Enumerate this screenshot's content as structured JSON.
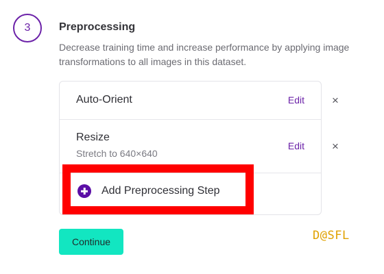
{
  "step": {
    "number": "3",
    "title": "Preprocessing",
    "description": "Decrease training time and increase performance by applying image transformations to all images in this dataset."
  },
  "preprocessing_steps": [
    {
      "name": "Auto-Orient",
      "detail": "",
      "edit_label": "Edit",
      "remove_label": "×"
    },
    {
      "name": "Resize",
      "detail": "Stretch to 640×640",
      "edit_label": "Edit",
      "remove_label": "×"
    }
  ],
  "add_step": {
    "label": "Add Preprocessing Step",
    "icon": "plus-circle-icon"
  },
  "continue_label": "Continue",
  "watermark": "D@SFL",
  "colors": {
    "accent": "#6b21a8",
    "continue_button": "#12e6c1",
    "highlight": "#ff0000",
    "watermark": "#e0a100"
  }
}
